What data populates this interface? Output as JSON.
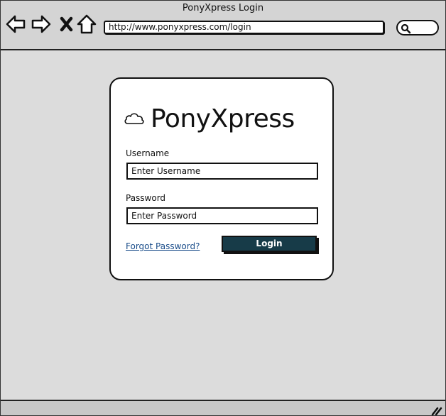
{
  "window": {
    "title": "PonyXpress Login"
  },
  "toolbar": {
    "url": "http://www.ponyxpress.com/login",
    "buttons": [
      {
        "name": "back",
        "icon": "arrow-left-icon"
      },
      {
        "name": "forward",
        "icon": "arrow-right-icon"
      },
      {
        "name": "stop",
        "icon": "close-icon"
      },
      {
        "name": "home",
        "icon": "home-icon"
      }
    ],
    "search_icon": "search-icon"
  },
  "login": {
    "brand_name": "PonyXpress",
    "brand_icon": "cloud-icon",
    "username_label": "Username",
    "username_placeholder": "Enter Username",
    "password_label": "Password",
    "password_placeholder": "Enter Password",
    "forgot_link": "Forgot Password?",
    "login_button": "Login"
  },
  "colors": {
    "background": "#dcdcdc",
    "button": "#173b48",
    "link": "#1a4d8a"
  }
}
